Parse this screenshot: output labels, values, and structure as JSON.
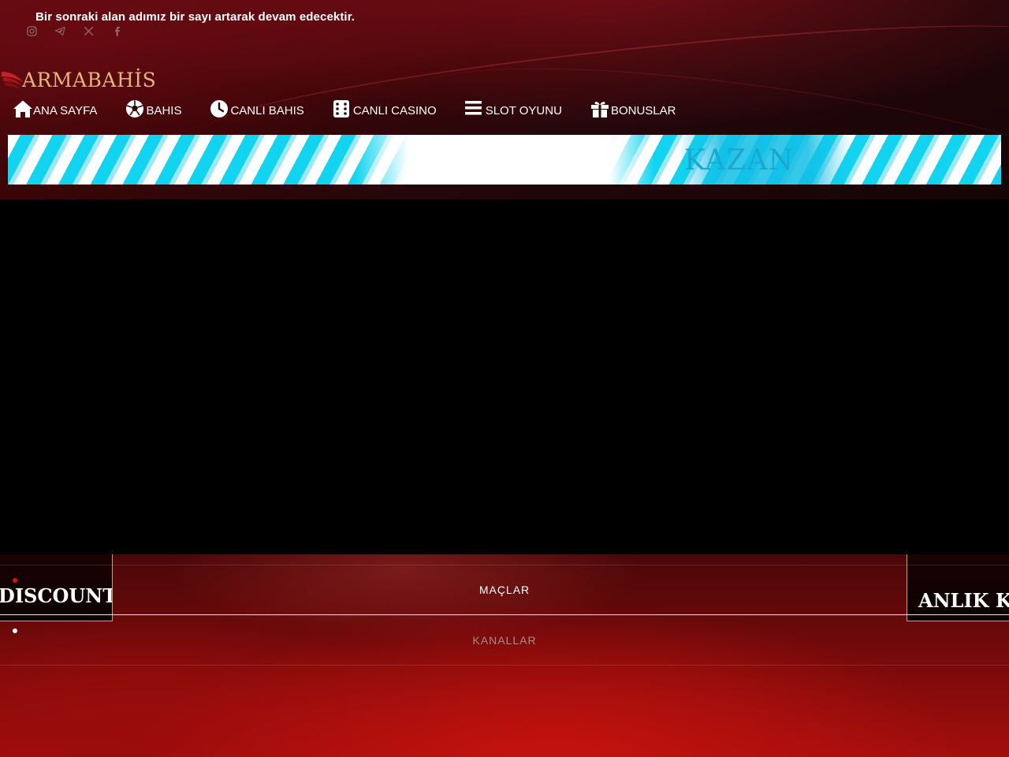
{
  "notice": "Bir sonraki alan adımız bir sayı artarak devam edecektir.",
  "socials": [
    {
      "icon": "instagram-icon"
    },
    {
      "icon": "telegram-icon"
    },
    {
      "icon": "x-icon"
    },
    {
      "icon": "facebook-icon"
    }
  ],
  "logo": {
    "text": "ArmaBahis",
    "display": "ARMABAHİS",
    "color": "#e3b67a"
  },
  "nav": [
    {
      "label": "ANA SAYFA",
      "icon": "home-icon"
    },
    {
      "label": "BAHIS",
      "icon": "soccer-ball-icon"
    },
    {
      "label": "CANLI BAHIS",
      "icon": "clock-icon"
    },
    {
      "label": "CANLI CASINO",
      "icon": "dice-icon"
    },
    {
      "label": "SLOT OYUNU",
      "icon": "menu-icon"
    },
    {
      "label": "BONUSLAR",
      "icon": "gift-icon"
    }
  ],
  "banner": {
    "text": "KAZAN"
  },
  "tabs": [
    {
      "label": "MAÇLAR",
      "active": true
    },
    {
      "label": "KANALLAR",
      "active": false
    }
  ],
  "side_cards": {
    "left": "DISCOUNT",
    "right": "ANLIK KA"
  },
  "colors": {
    "accent_gold": "#c9a36b",
    "banner_cyan": "#12d4f0",
    "active_dot": "#e01010",
    "inactive_dot": "#ffffff"
  }
}
